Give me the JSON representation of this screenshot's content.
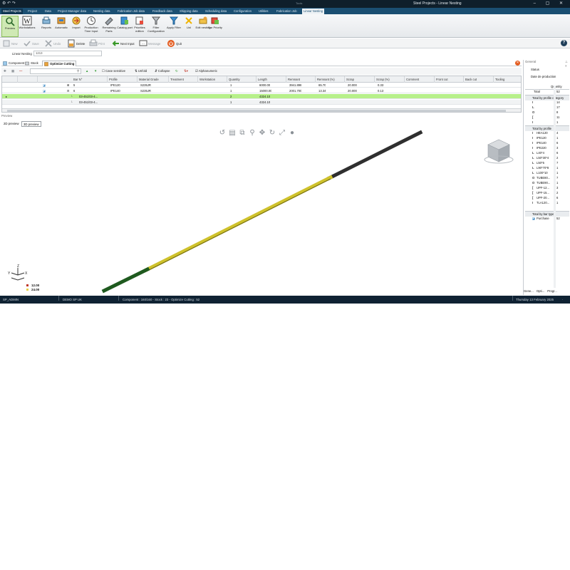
{
  "window": {
    "quick_access": "⚙ ↶ ↷",
    "mid_caption": "Tools",
    "title": "Steel Projects - Linear Nesting",
    "controls": "– ▢ ✕"
  },
  "ribbon_tabs": [
    "Steel Projects",
    "Project",
    "Data",
    "Project Manager data",
    "Nesting data",
    "Fabrication Job data",
    "Feedback data",
    "Shipping data",
    "Scheduling data",
    "Configuration",
    "Utilities",
    "Fabrication Job",
    "Linear Nesting"
  ],
  "ribbon_buttons": [
    {
      "label": "Preview",
      "icon": "preview-icon"
    },
    {
      "label": "Workstations",
      "icon": "workstations-icon"
    },
    {
      "label": "Reports",
      "icon": "reports-icon"
    },
    {
      "label": "Automatic",
      "icon": "automatic-icon"
    },
    {
      "label": "Import",
      "icon": "import-icon"
    },
    {
      "label": "Production Time Input",
      "icon": "production-time-icon"
    },
    {
      "label": "Remaining Parts",
      "icon": "remaining-parts-icon"
    },
    {
      "label": "Catalog part",
      "icon": "catalog-part-icon"
    },
    {
      "label": "Priorities edition",
      "icon": "priorities-icon"
    },
    {
      "label": "Filter Configuration",
      "icon": "filter-config-icon"
    },
    {
      "label": "Apply Filter",
      "icon": "apply-filter-icon"
    },
    {
      "label": "Unl",
      "icon": "unl-icon"
    },
    {
      "label": "Edit nesting",
      "icon": "edit-nesting-icon"
    },
    {
      "label": "Bar Priority",
      "icon": "bar-priority-icon"
    }
  ],
  "toolbar": {
    "new": "New",
    "save": "Save",
    "undo": "Undo",
    "delete": "Delete",
    "print": "Print",
    "next_input": "Next Input",
    "message": "Message",
    "quit": "Quit",
    "help": "?"
  },
  "nesting": {
    "label": "Linear Nesting",
    "value": "1213"
  },
  "panel_tabs": [
    "Component",
    "Stock",
    "Optimize Cutting"
  ],
  "grid_toolbar": {
    "case_sensitive": "Case sensitive",
    "unfold": "Unfold",
    "collapse": "Collapse",
    "alphanumeric": "Alphanumeric"
  },
  "grid": {
    "columns": [
      "Bar N°",
      "Profile",
      "Material Grade",
      "Treatment",
      "Workstation",
      "Quantity",
      "Length",
      "Remnant",
      "Remnant (%)",
      "Scrap",
      "Scrap (%)",
      "Comment",
      "Front cut",
      "Back cut",
      "Tooling"
    ],
    "rows": [
      {
        "bar": "5",
        "profile": "IPE120",
        "grade": "S235JR",
        "quantity": "1",
        "length": "6000.00",
        "remnant": "3941.898",
        "remnant_pct": "65.70",
        "scrap": "20.000",
        "scrap_pct": "0.33"
      },
      {
        "bar": "6",
        "profile": "IPE140",
        "grade": "S235JR",
        "quantity": "1",
        "length": "15000.00",
        "remnant": "2001.700",
        "remnant_pct": "13.34",
        "scrap": "20.000",
        "scrap_pct": "0.13"
      },
      {
        "bar": "03-451/03-4...",
        "quantity": "2",
        "length": "4324.10"
      },
      {
        "bar": "03-451/03-4...",
        "quantity": "1",
        "length": "4324.10"
      }
    ]
  },
  "preview": {
    "title": "Preview",
    "tabs": [
      "2D preview",
      "3D preview"
    ],
    "legend": [
      {
        "label": "12.00",
        "color": "#c0392b"
      },
      {
        "label": "24.00",
        "color": "#e8d34a"
      }
    ],
    "bar_colors": {
      "dark": "#2f2f2f",
      "yellow": "#cfc22c",
      "green": "#1f5a1f"
    }
  },
  "right_panel": {
    "title": "General",
    "status_label": "Status",
    "production_date_label": "Date de production",
    "quantity_header": "Quantity",
    "total_label": "Total",
    "total_value": "52",
    "by_category_title": "Total by profile category",
    "by_category": [
      {
        "sym": "I",
        "qty": "14"
      },
      {
        "sym": "L",
        "qty": "17"
      },
      {
        "sym": "O",
        "qty": "8"
      },
      {
        "sym": "[",
        "qty": "11"
      },
      {
        "sym": "I",
        "qty": "1"
      }
    ],
    "by_profile_title": "Total by profile",
    "by_profile": [
      {
        "sym": "I",
        "name": "HEA120",
        "qty": "4"
      },
      {
        "sym": "I",
        "name": "IPE120",
        "qty": "1"
      },
      {
        "sym": "I",
        "name": "IPE140",
        "qty": "6"
      },
      {
        "sym": "I",
        "name": "IPE220",
        "qty": "3"
      },
      {
        "sym": "L",
        "name": "L40*4",
        "qty": "6"
      },
      {
        "sym": "L",
        "name": "L50*30*4",
        "qty": "2"
      },
      {
        "sym": "L",
        "name": "L50*5",
        "qty": "7"
      },
      {
        "sym": "L",
        "name": "L90*70*8",
        "qty": "1"
      },
      {
        "sym": "L",
        "name": "L100*10",
        "qty": "1"
      },
      {
        "sym": "O",
        "name": "TUBE80...",
        "qty": "7"
      },
      {
        "sym": "O",
        "name": "TUBE90...",
        "qty": "1"
      },
      {
        "sym": "[",
        "name": "UPF-12...",
        "qty": "3"
      },
      {
        "sym": "[",
        "name": "UPF-15...",
        "qty": "2"
      },
      {
        "sym": "[",
        "name": "UPF-20...",
        "qty": "6"
      },
      {
        "sym": "I",
        "name": "TLA120...",
        "qty": "1"
      }
    ],
    "by_bar_type_title": "Total by bar type",
    "by_bar_type": [
      {
        "name": "Purchase",
        "qty": "52"
      }
    ],
    "bottom_tabs": [
      "Gene...",
      "Opti...",
      "Progr...",
      "Parti..."
    ]
  },
  "statusbar": {
    "user": "SP_ADMIN",
    "company": "DEMO SP UK",
    "info": "Component : 160/160 - Stock : 23 - Optimize Cutting : 52",
    "date": "Thursday 13 February 2025",
    "end": "∙"
  },
  "accent": "#1b4f72"
}
